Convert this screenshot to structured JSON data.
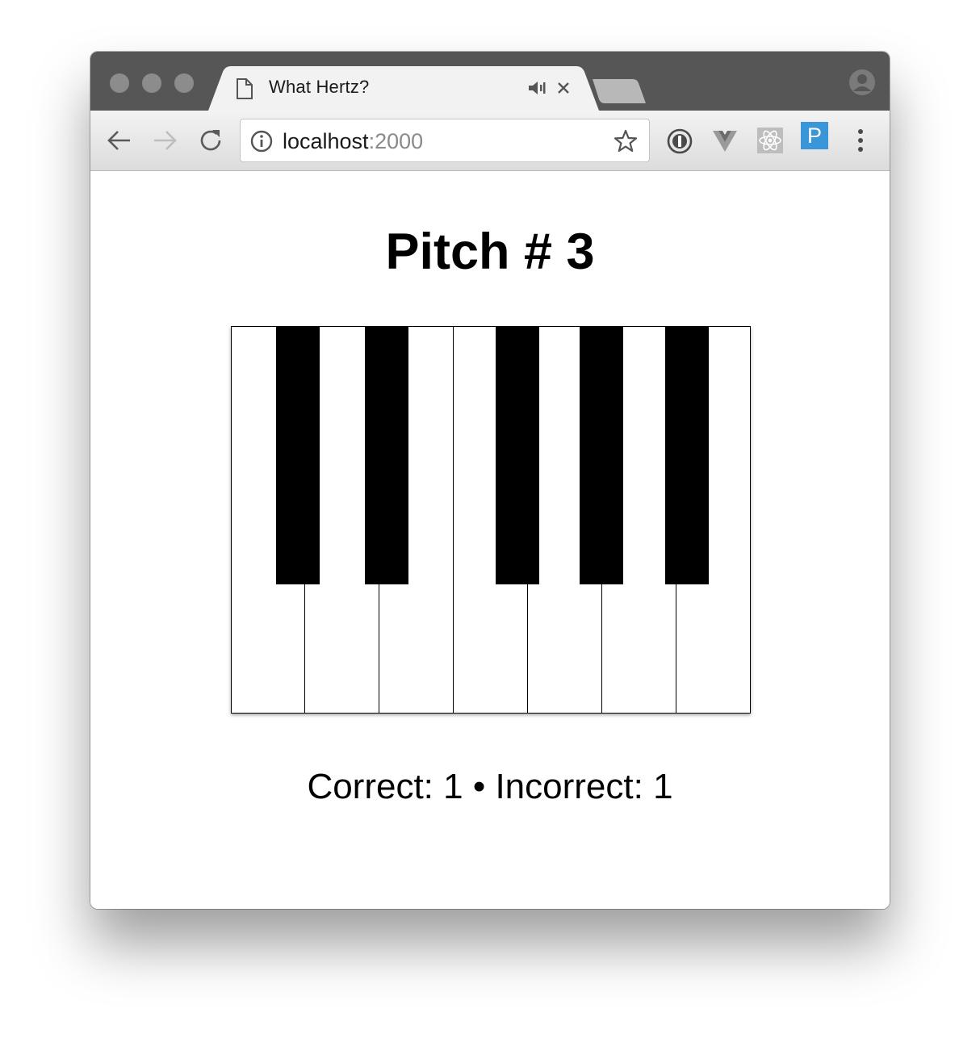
{
  "window": {
    "tab": {
      "title": "What Hertz?"
    },
    "address": {
      "host": "localhost",
      "port": ":2000"
    },
    "extensions": {
      "p_label": "P"
    },
    "icons": [
      "document-icon",
      "audio-playing-icon",
      "close-icon",
      "profile-icon",
      "back-arrow-icon",
      "forward-arrow-icon",
      "reload-icon",
      "info-icon",
      "star-icon",
      "onepassword-icon",
      "vue-devtools-icon",
      "react-devtools-icon",
      "menu-dots-icon"
    ]
  },
  "app": {
    "heading": "Pitch # 3",
    "score": "Correct: 1 • Incorrect: 1",
    "piano": {
      "white_keys": 7,
      "black_keys": 5
    }
  },
  "colors": {
    "accent_extension": "#3b95d9",
    "tabbar": "#565656"
  }
}
